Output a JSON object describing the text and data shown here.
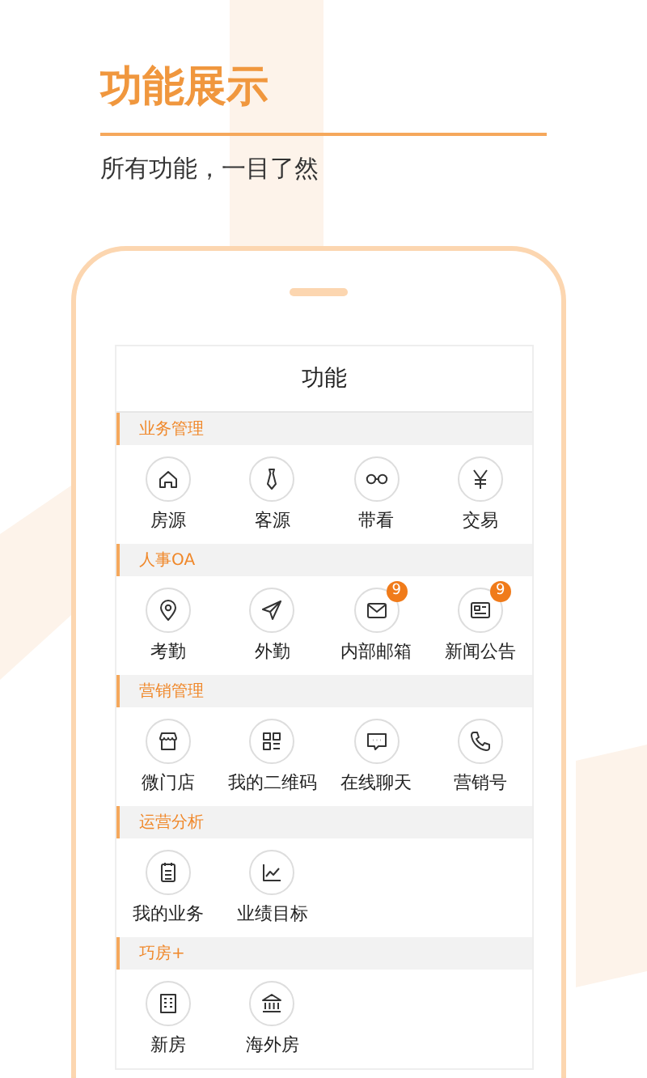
{
  "heading": {
    "title": "功能展示",
    "subtitle": "所有功能，一目了然"
  },
  "screen": {
    "title": "功能",
    "sections": [
      {
        "name": "业务管理",
        "items": [
          {
            "label": "房源",
            "kind": "house"
          },
          {
            "label": "客源",
            "kind": "tie"
          },
          {
            "label": "带看",
            "kind": "glasses"
          },
          {
            "label": "交易",
            "kind": "yen"
          }
        ]
      },
      {
        "name": "人事OA",
        "items": [
          {
            "label": "考勤",
            "kind": "pin"
          },
          {
            "label": "外勤",
            "kind": "plane"
          },
          {
            "label": "内部邮箱",
            "kind": "mail",
            "badge": "9"
          },
          {
            "label": "新闻公告",
            "kind": "news",
            "badge": "9"
          }
        ]
      },
      {
        "name": "营销管理",
        "items": [
          {
            "label": "微门店",
            "kind": "shop"
          },
          {
            "label": "我的二维码",
            "kind": "qr"
          },
          {
            "label": "在线聊天",
            "kind": "chat"
          },
          {
            "label": "营销号",
            "kind": "phone"
          }
        ]
      },
      {
        "name": "运营分析",
        "items": [
          {
            "label": "我的业务",
            "kind": "notepad"
          },
          {
            "label": "业绩目标",
            "kind": "chart"
          }
        ]
      },
      {
        "name": "巧房+",
        "items": [
          {
            "label": "新房",
            "kind": "building"
          },
          {
            "label": "海外房",
            "kind": "bank"
          }
        ]
      }
    ]
  }
}
